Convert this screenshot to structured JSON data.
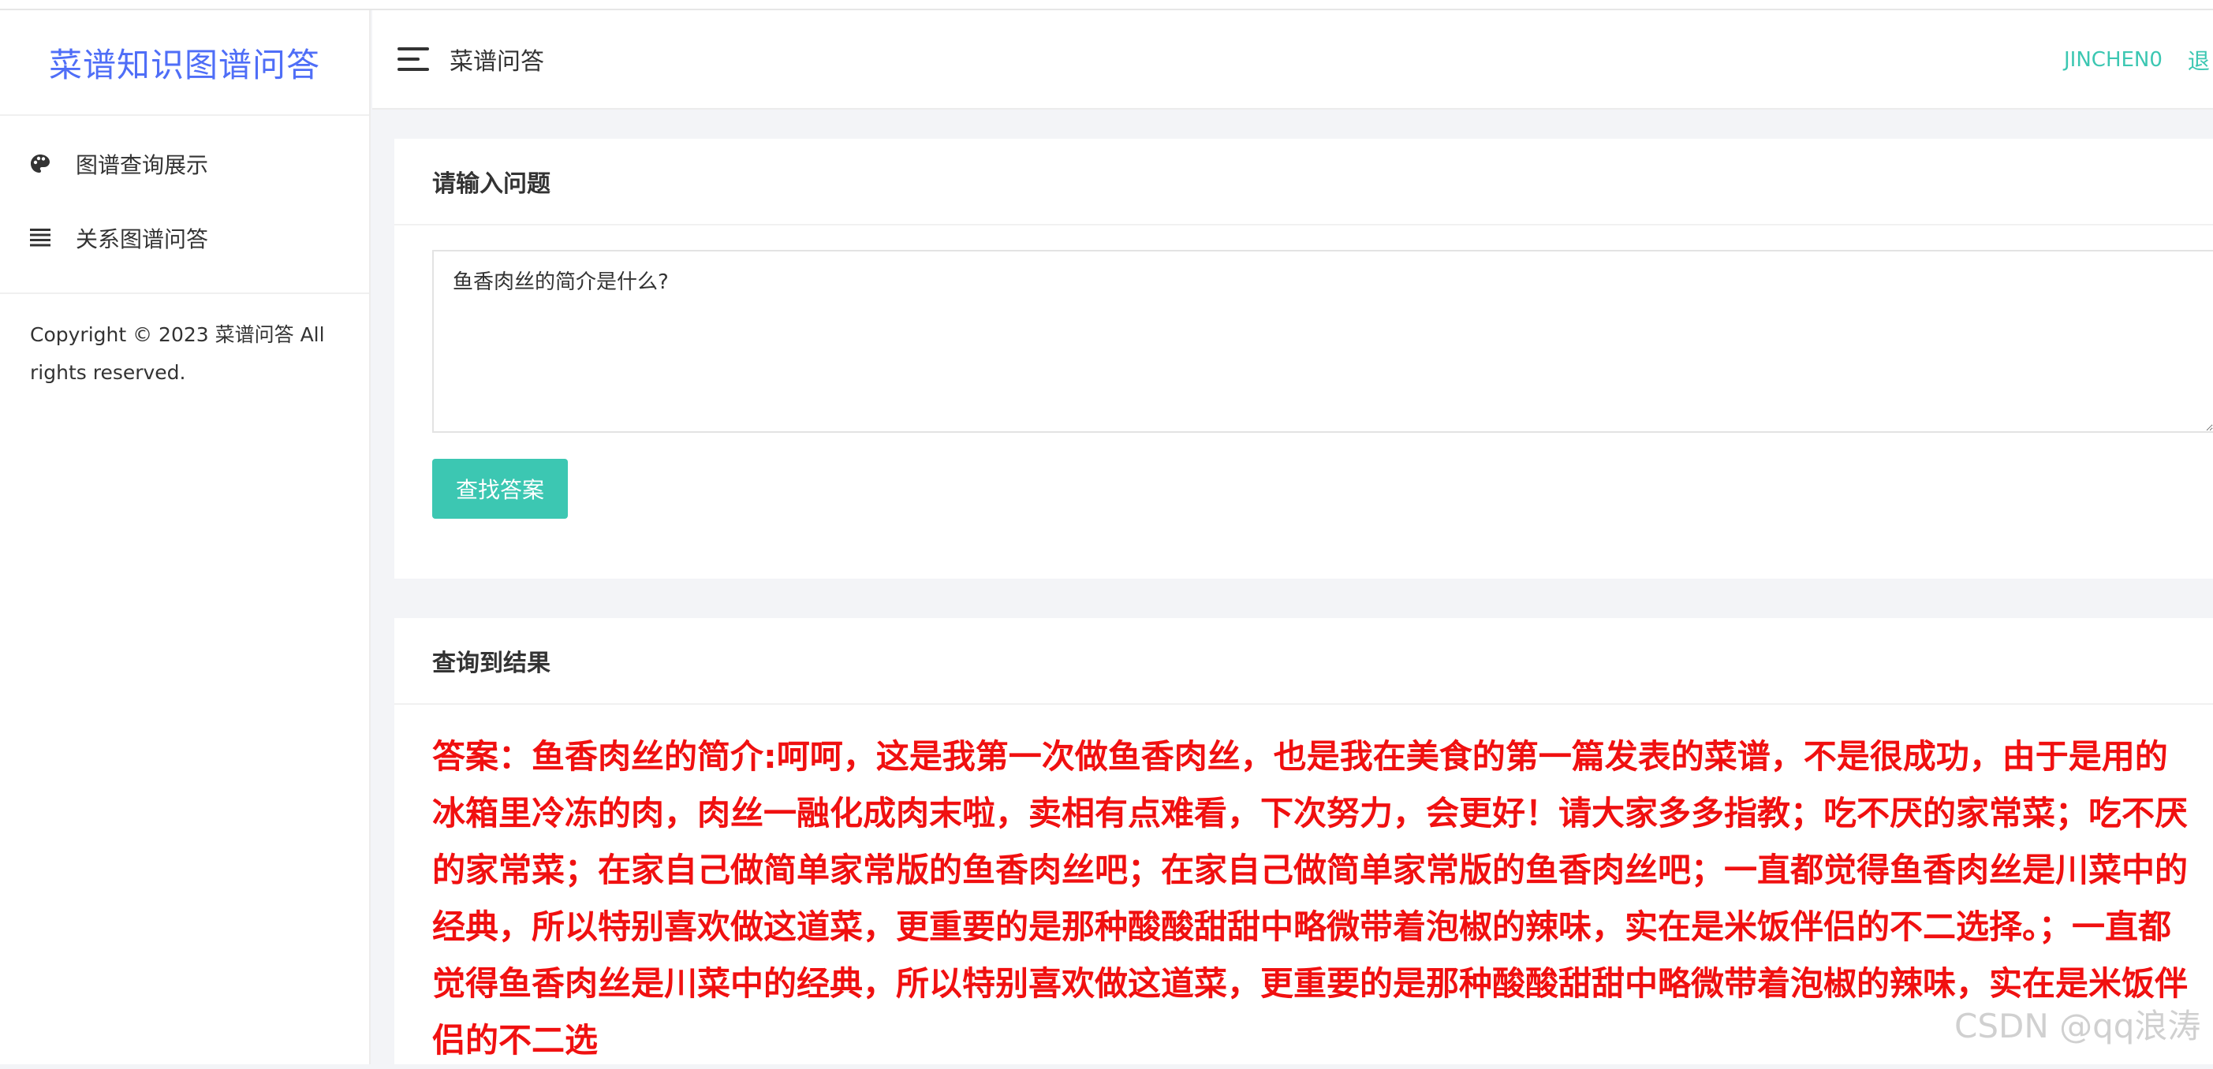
{
  "sidebar": {
    "brand": "菜谱知识图谱问答",
    "items": [
      {
        "label": "图谱查询展示",
        "icon": "palette-icon"
      },
      {
        "label": "关系图谱问答",
        "icon": "list-icon"
      }
    ],
    "copyright": "Copyright © 2023 菜谱问答 All rights reserved."
  },
  "header": {
    "title": "菜谱问答",
    "user": "JINCHEN0",
    "logout": "退"
  },
  "question_card": {
    "title": "请输入问题",
    "input_value": "鱼香肉丝的简介是什么?",
    "submit_label": "查找答案"
  },
  "result_card": {
    "title": "查询到结果",
    "answer": "答案：鱼香肉丝的简介:呵呵，这是我第一次做鱼香肉丝，也是我在美食的第一篇发表的菜谱，不是很成功，由于是用的冰箱里冷冻的肉，肉丝一融化成肉末啦，卖相有点难看，下次努力，会更好！请大家多多指教；吃不厌的家常菜；吃不厌的家常菜；在家自己做简单家常版的鱼香肉丝吧；在家自己做简单家常版的鱼香肉丝吧；一直都觉得鱼香肉丝是川菜中的经典，所以特别喜欢做这道菜，更重要的是那种酸酸甜甜中略微带着泡椒的辣味，实在是米饭伴侣的不二选择。；一直都觉得鱼香肉丝是川菜中的经典，所以特别喜欢做这道菜，更重要的是那种酸酸甜甜中略微带着泡椒的辣味，实在是米饭伴侣的不二选"
  },
  "watermark": "CSDN @qq浪涛",
  "colors": {
    "brand": "#4f6ef7",
    "accent": "#3cc7b2",
    "answer": "#f01010"
  }
}
